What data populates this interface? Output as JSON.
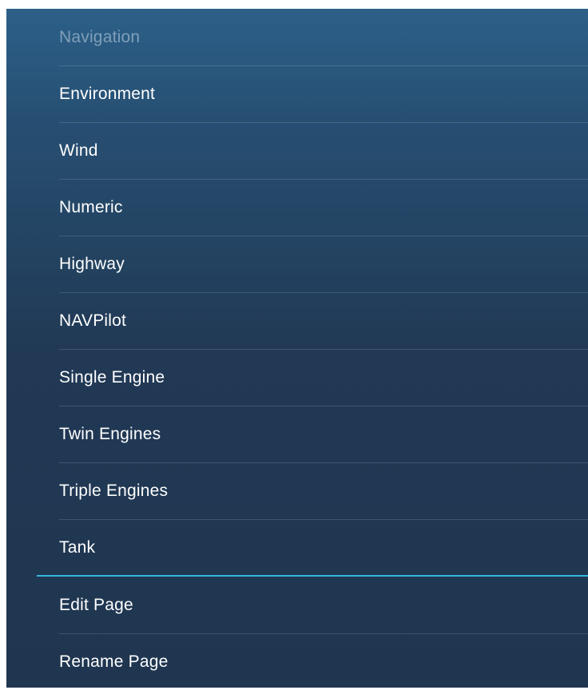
{
  "menu": {
    "page_items": [
      {
        "label": "Navigation",
        "state": "dimmed"
      },
      {
        "label": "Environment"
      },
      {
        "label": "Wind"
      },
      {
        "label": "Numeric"
      },
      {
        "label": "Highway"
      },
      {
        "label": "NAVPilot"
      },
      {
        "label": "Single Engine"
      },
      {
        "label": "Twin Engines"
      },
      {
        "label": "Triple Engines"
      },
      {
        "label": "Tank"
      }
    ],
    "actions": [
      {
        "label": "Edit Page"
      },
      {
        "label": "Rename Page"
      }
    ]
  },
  "colors": {
    "panel_top": "#2c6088",
    "panel_bottom": "#203650",
    "section_divider": "#36b6dc",
    "dimmed_text": "#7f9fba",
    "text": "#ffffff"
  }
}
